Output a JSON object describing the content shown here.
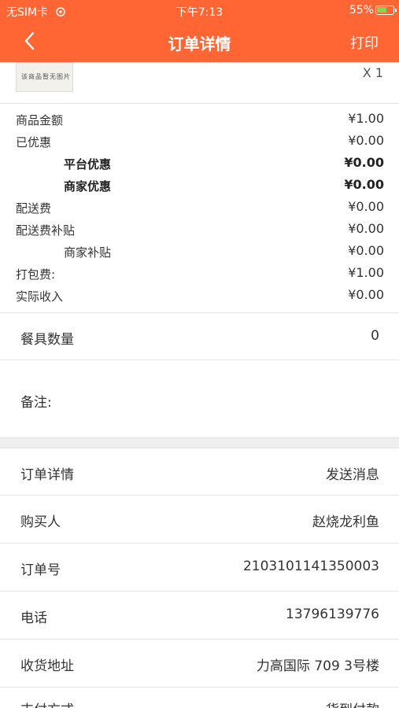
{
  "status_bar": {
    "carrier": "无SIM卡",
    "time": "下午7:13",
    "battery": "55%"
  },
  "nav": {
    "title": "订单详情",
    "print_label": "打印"
  },
  "product": {
    "quantity": "X 1",
    "thumbnail_text": "该商品暂无图片"
  },
  "fees": [
    {
      "label": "商品金额",
      "value": "¥1.00"
    },
    {
      "label": "已优惠",
      "value": "¥0.00"
    },
    {
      "label": "平台优惠",
      "value": "¥0.00"
    },
    {
      "label": "商家优惠",
      "value": "¥0.00"
    },
    {
      "label": "配送费",
      "value": "¥0.00"
    },
    {
      "label": "配送费补贴",
      "value": "¥0.00"
    },
    {
      "label": "商家补贴",
      "value": "¥0.00"
    },
    {
      "label": "打包费:",
      "value": "¥1.00"
    },
    {
      "label": "实际收入",
      "value": "¥0.00"
    }
  ],
  "tableware": {
    "label": "餐具数量",
    "value": "0"
  },
  "remark": {
    "label": "备注:"
  },
  "details": [
    {
      "label": "订单详情",
      "value": "发送消息"
    },
    {
      "label": "购买人",
      "value": "赵烧龙利鱼"
    },
    {
      "label": "订单号",
      "value": "2103101141350003"
    },
    {
      "label": "电话",
      "value": "13796139776"
    },
    {
      "label": "收货地址",
      "value": "力高国际 709 3号楼"
    },
    {
      "label": "支付方式",
      "value": "货到付款"
    }
  ],
  "colors": {
    "header": "#ff6633",
    "battery_fill": "#7ed957"
  },
  "icons": {
    "back": "chevron-left-icon",
    "wifi": "wifi-icon",
    "battery": "battery-charging-icon"
  }
}
